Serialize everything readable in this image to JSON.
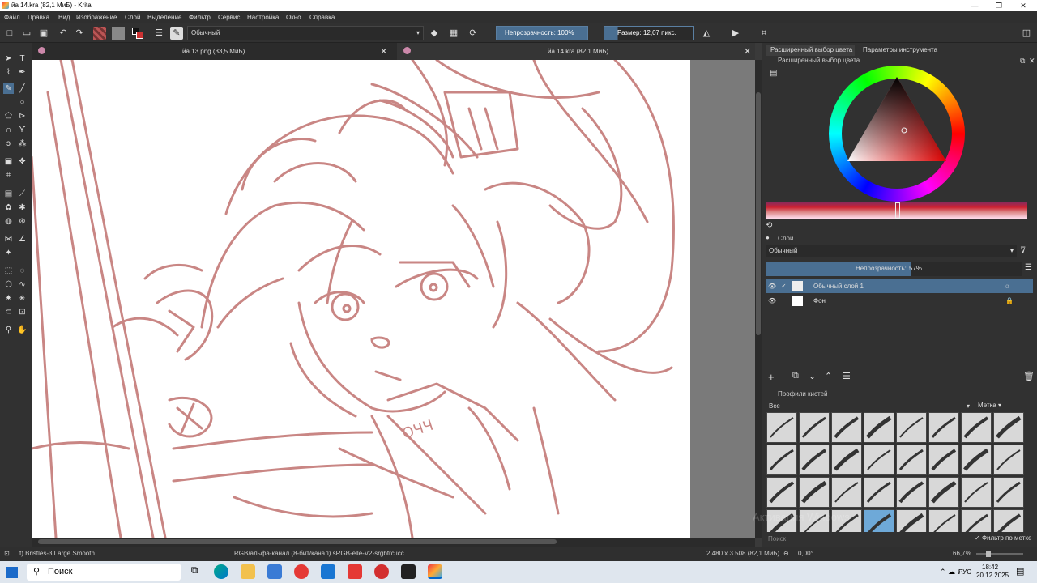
{
  "window": {
    "title": "йа 14.kra (82,1 МиБ) - Krita"
  },
  "menu": [
    "Файл",
    "Правка",
    "Вид",
    "Изображение",
    "Слой",
    "Выделение",
    "Фильтр",
    "Сервис",
    "Настройка",
    "Окно",
    "Справка"
  ],
  "toolbar": {
    "blend_mode": "Обычный",
    "opacity": "Непрозрачность: 100%",
    "size": "Размер: 12,07 пикс."
  },
  "tabs": [
    {
      "label": "йа 13.png (33,5 МиБ)",
      "active": false
    },
    {
      "label": "йа 14.kra (82,1 МиБ)",
      "active": true
    }
  ],
  "dock": {
    "tabs": [
      "Расширенный выбор цвета",
      "Параметры инструмента"
    ],
    "color_title": "Расширенный выбор цвета",
    "layers_title": "Слои",
    "layers_blend": "Обычный",
    "layers_opacity_label": "Непрозрачность:",
    "layers_opacity": "57%",
    "layers": [
      {
        "name": "Обычный слой 1",
        "selected": true
      },
      {
        "name": "Фон",
        "selected": false
      }
    ],
    "brush_title": "Профили кистей",
    "brush_filter": "Все",
    "brush_tag": "Метка",
    "search_placeholder": "Поиск",
    "filter_by_tag": "Фильтр по метке"
  },
  "status": {
    "brush": "f) Bristles-3 Large Smooth",
    "colorspace": "RGB/альфа-канал (8-бит/канал)  sRGB-elle-V2-srgbtrc.icc",
    "dims": "2 480 x 3 508 (82,1 МиБ)",
    "rotation": "0,00°",
    "zoom": "66,7%"
  },
  "taskbar": {
    "search": "Поиск",
    "lang": "РУС",
    "time": "18:42",
    "date": "20.12.2025"
  },
  "canvas_text": "ОЧЧ",
  "watermark": "Активация Windows"
}
